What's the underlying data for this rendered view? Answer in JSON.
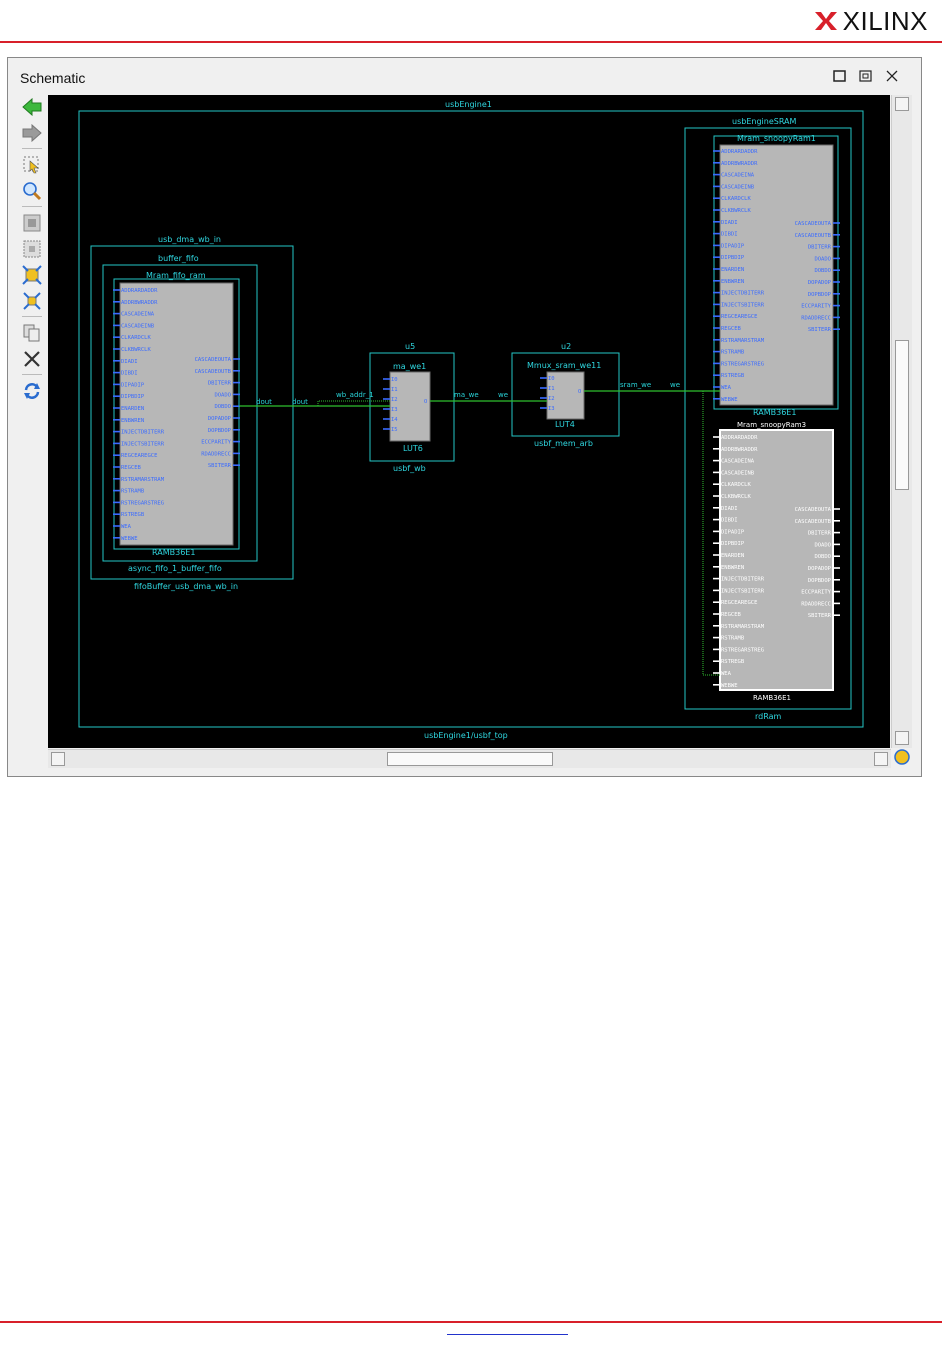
{
  "header": {
    "logo_text": "XILINX",
    "logo_mark": "®",
    "logo_color": "#d8202a"
  },
  "window": {
    "title": "Schematic",
    "controls": [
      "maximize-icon",
      "restore-icon",
      "close-icon"
    ]
  },
  "toolbar": {
    "icons": [
      "back-arrow-icon",
      "forward-arrow-icon",
      "select-icon",
      "zoom-icon",
      "zoom-fit-icon",
      "zoom-area-icon",
      "expand-icon",
      "collapse-icon",
      "copy-icon",
      "delete-icon",
      "refresh-icon"
    ]
  },
  "schematic": {
    "top_cell": "usbEngine1",
    "top_cell_bottom": "usbEngine1/usbf_top",
    "left_outer": {
      "title": "usb_dma_wb_in",
      "bottom": "fifoBuffer_usb_dma_wb_in"
    },
    "left_inner": {
      "title": "buffer_fifo",
      "bottom": "async_fifo_1_buffer_fifo"
    },
    "left_ram": {
      "title": "Mram_fifo_ram",
      "type": "RAMB36E1",
      "in_pins": [
        "ADDRARDADDR",
        "ADDRBWRADDR",
        "CASCADEINA",
        "CASCADEINB",
        "CLKARDCLK",
        "CLKBWRCLK",
        "DIADI",
        "DIBDI",
        "DIPADIP",
        "DIPBDIP",
        "ENARDEN",
        "ENBWREN",
        "INJECTDBITERR",
        "INJECTSBITERR",
        "REGCEAREGCE",
        "REGCEB",
        "RSTRAMARSTRAM",
        "RSTRAMB",
        "RSTREGARSTREG",
        "RSTREGB",
        "WEA",
        "WEBWE"
      ],
      "out_pins": [
        "CASCADEOUTA",
        "CASCADEOUTB",
        "DBITERR",
        "DOADO",
        "DOBDO",
        "DOPADOP",
        "DOPBDOP",
        "ECCPARITY",
        "RDADDRECC",
        "SBITERR"
      ]
    },
    "u5": {
      "inst": "u5",
      "title": "ma_we1",
      "type": "LUT6",
      "bottom": "usbf_wb",
      "pins": [
        "I0",
        "I1",
        "I2",
        "I3",
        "I4",
        "I5"
      ],
      "out": "O"
    },
    "u2": {
      "inst": "u2",
      "title": "Mmux_sram_we11",
      "type": "LUT4",
      "bottom": "usbf_mem_arb",
      "pins": [
        "I0",
        "I1",
        "I2",
        "I3"
      ],
      "out": "O"
    },
    "right_outer": {
      "title": "usbEngineSRAM",
      "bottom": "rdRam"
    },
    "right_ram1": {
      "title": "Mram_snoopyRam1",
      "type": "RAMB36E1"
    },
    "right_ram2": {
      "title": "Mram_snoopyRam3",
      "type": "RAMB36E1"
    },
    "nets": {
      "n1": "dout",
      "n2": "dout",
      "n3": "wb_addr_1",
      "n4": "ma_we",
      "n5": "we",
      "n6": "sram_we",
      "n7": "we"
    }
  },
  "footer": {
    "link_text": ""
  }
}
